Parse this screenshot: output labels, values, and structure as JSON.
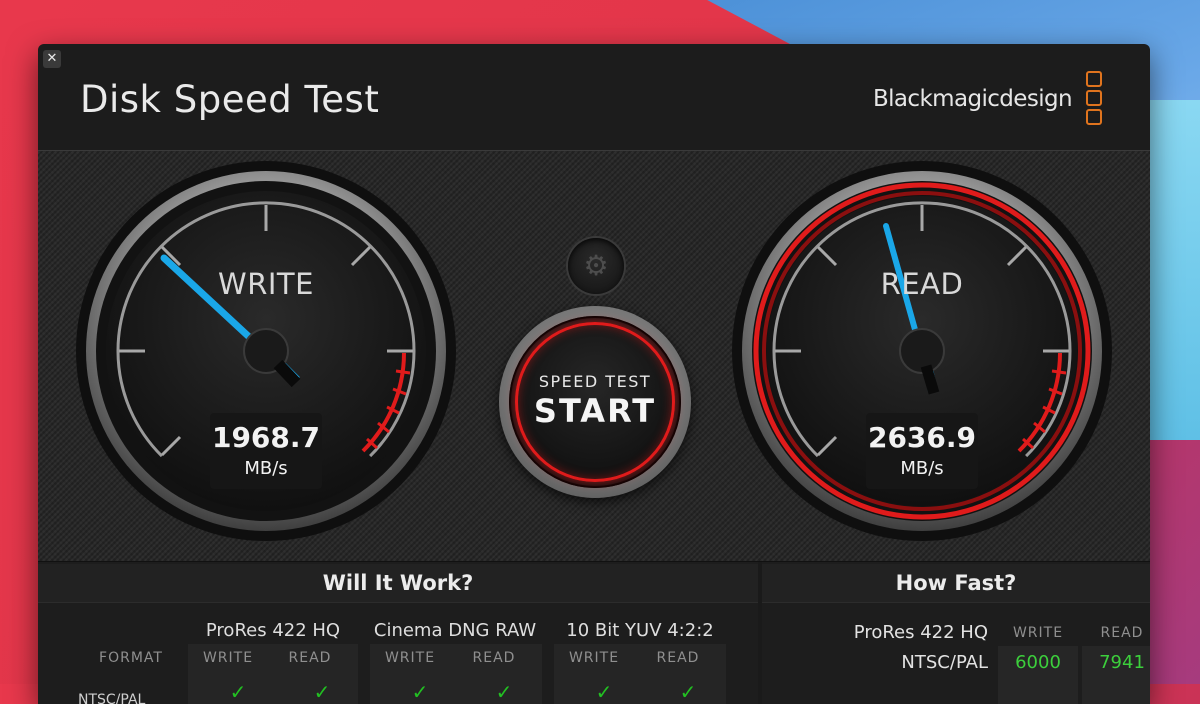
{
  "app": {
    "title": "Disk Speed Test",
    "brand": "Blackmagicdesign",
    "accent_color": "#e0741e"
  },
  "write_gauge": {
    "label": "WRITE",
    "value": "1968.7",
    "unit": "MB/s",
    "needle_color": "#1aa7e8"
  },
  "read_gauge": {
    "label": "READ",
    "value": "2636.9",
    "unit": "MB/s",
    "needle_color": "#1aa7e8",
    "ring_color": "#e01b1b"
  },
  "controls": {
    "settings_icon": "gear-icon",
    "start_subtitle": "SPEED TEST",
    "start_label": "START"
  },
  "will_it_work": {
    "title": "Will It Work?",
    "format_label": "FORMAT",
    "row_partial": "NTSC/PAL",
    "codecs": [
      {
        "name": "ProRes 422 HQ",
        "write": "WRITE",
        "read": "READ"
      },
      {
        "name": "Cinema DNG RAW",
        "write": "WRITE",
        "read": "READ"
      },
      {
        "name": "10 Bit YUV 4:2:2",
        "write": "WRITE",
        "read": "READ"
      }
    ],
    "check_glyph": "✓",
    "check_color": "#22c022"
  },
  "how_fast": {
    "title": "How Fast?",
    "codec": "ProRes 422 HQ",
    "write_head": "WRITE",
    "read_head": "READ",
    "rows": [
      {
        "label": "NTSC/PAL",
        "write": "6000",
        "read": "7941"
      }
    ],
    "value_color": "#3ccf3c"
  }
}
